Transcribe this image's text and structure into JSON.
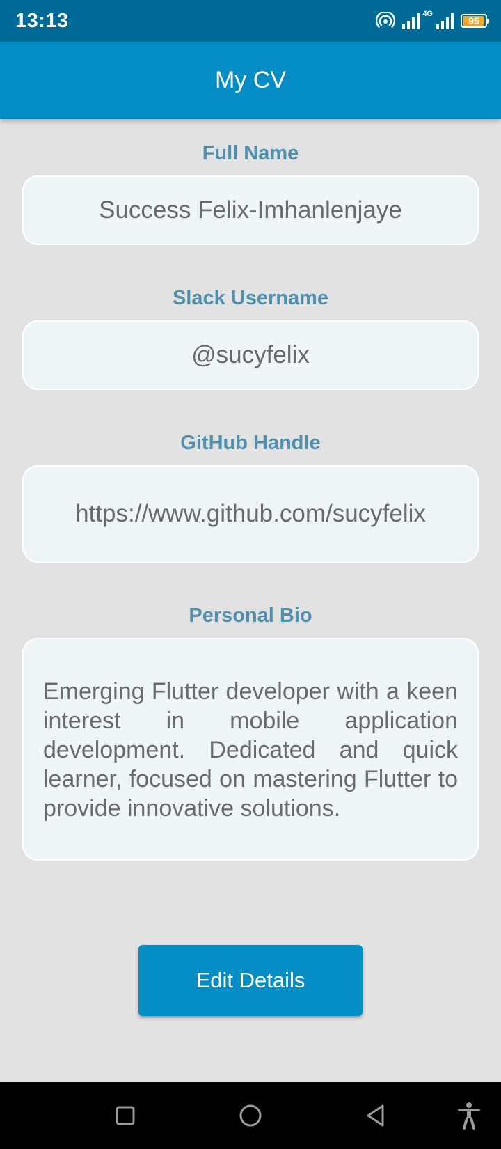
{
  "status_bar": {
    "time": "13:13",
    "network": "4G",
    "battery": "95",
    "battery_level": 0.95,
    "battery_color": "#f5a623"
  },
  "app_bar": {
    "title": "My CV"
  },
  "fields": {
    "full_name": {
      "label": "Full Name",
      "value": "Success Felix-Imhanlenjaye"
    },
    "slack": {
      "label": "Slack Username",
      "value": "@sucyfelix"
    },
    "github": {
      "label": "GitHub Handle",
      "value": "https://www.github.com/sucyfelix"
    },
    "bio": {
      "label": "Personal Bio",
      "value": "Emerging Flutter developer with a keen interest in mobile application development. Dedicated and quick learner, focused on mastering Flutter to provide innovative solutions."
    }
  },
  "actions": {
    "edit_label": "Edit Details"
  },
  "nav": {
    "icons": [
      "recents-icon",
      "home-icon",
      "back-icon",
      "accessibility-icon"
    ]
  },
  "colors": {
    "app_bar": "#048cc4",
    "status_bar": "#006a96",
    "label": "#5090ac",
    "background": "#e2e2e2"
  }
}
